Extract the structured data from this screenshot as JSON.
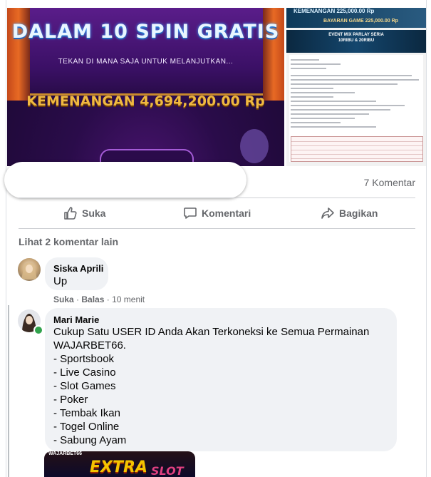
{
  "post": {
    "image_left": {
      "headline": "DALAM 10 SPIN GRATIS",
      "subline": "TEKAN DI MANA SAJA UNTUK MELANJUTKAN...",
      "winnings": "KEMENANGAN 4,694,200.00 Rp"
    },
    "image_right": {
      "banner_top": "KEMENANGAN 225,000.00 Rp",
      "banner_sub": "BAYARAN GAME 225,000.00 Rp",
      "event_banner": "EVENT MIX PARLAY SERIA 10RIBU & 20RIBU"
    },
    "comment_count": "7 Komentar"
  },
  "actions": {
    "like": "Suka",
    "comment": "Komentari",
    "share": "Bagikan"
  },
  "more_comments": "Lihat 2 komentar lain",
  "comments": [
    {
      "name": "Siska Aprili",
      "text": "Up",
      "meta_like": "Suka",
      "meta_reply": "Balas",
      "time": "10 menit"
    },
    {
      "name": "Mari Marie",
      "text": "Cukup Satu USER ID Anda Akan Terkoneksi ke Semua Permainan\nWAJARBET66.\n- Sportsbook\n- Live Casino\n- Slot Games\n- Poker\n- Tembak Ikan\n- Togel Online\n- Sabung Ayam",
      "attachment": {
        "brand": "WAJARBET66",
        "title_1": "EXTRA",
        "title_2": "SLOT"
      }
    }
  ],
  "colors": {
    "accent": "#1877f2",
    "muted": "#65676b",
    "bubble": "#f0f2f5",
    "online": "#31a24c"
  }
}
